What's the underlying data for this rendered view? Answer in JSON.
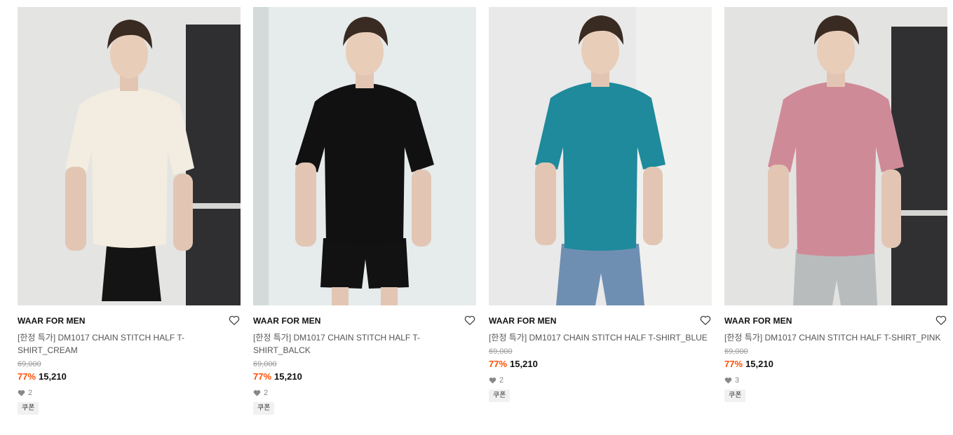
{
  "products": [
    {
      "brand": "WAAR FOR MEN",
      "name": "[한정 특가] DM1017 CHAIN STITCH HALF T-SHIRT_CREAM",
      "original_price": "69,000",
      "discount": "77%",
      "price": "15,210",
      "likes": "2",
      "badge": "쿠폰",
      "shirt_color": "#f2ede0",
      "bg_color": "#e4e4e2"
    },
    {
      "brand": "WAAR FOR MEN",
      "name": "[한정 특가] DM1017 CHAIN STITCH HALF T-SHIRT_BALCK",
      "original_price": "69,000",
      "discount": "77%",
      "price": "15,210",
      "likes": "2",
      "badge": "쿠폰",
      "shirt_color": "#111111",
      "bg_color": "#e6ebeb"
    },
    {
      "brand": "WAAR FOR MEN",
      "name": "[한정 특가] DM1017 CHAIN STITCH HALF T-SHIRT_BLUE",
      "original_price": "69,000",
      "discount": "77%",
      "price": "15,210",
      "likes": "2",
      "badge": "쿠폰",
      "shirt_color": "#1e8a9c",
      "bg_color": "#e8e9e8"
    },
    {
      "brand": "WAAR FOR MEN",
      "name": "[한정 특가] DM1017 CHAIN STITCH HALF T-SHIRT_PINK",
      "original_price": "69,000",
      "discount": "77%",
      "price": "15,210",
      "likes": "3",
      "badge": "쿠폰",
      "shirt_color": "#cf8a98",
      "bg_color": "#e3e3e1"
    }
  ],
  "colors": {
    "discount": "#ff4d00",
    "heart_outline": "#333333",
    "heart_small": "#888888"
  }
}
